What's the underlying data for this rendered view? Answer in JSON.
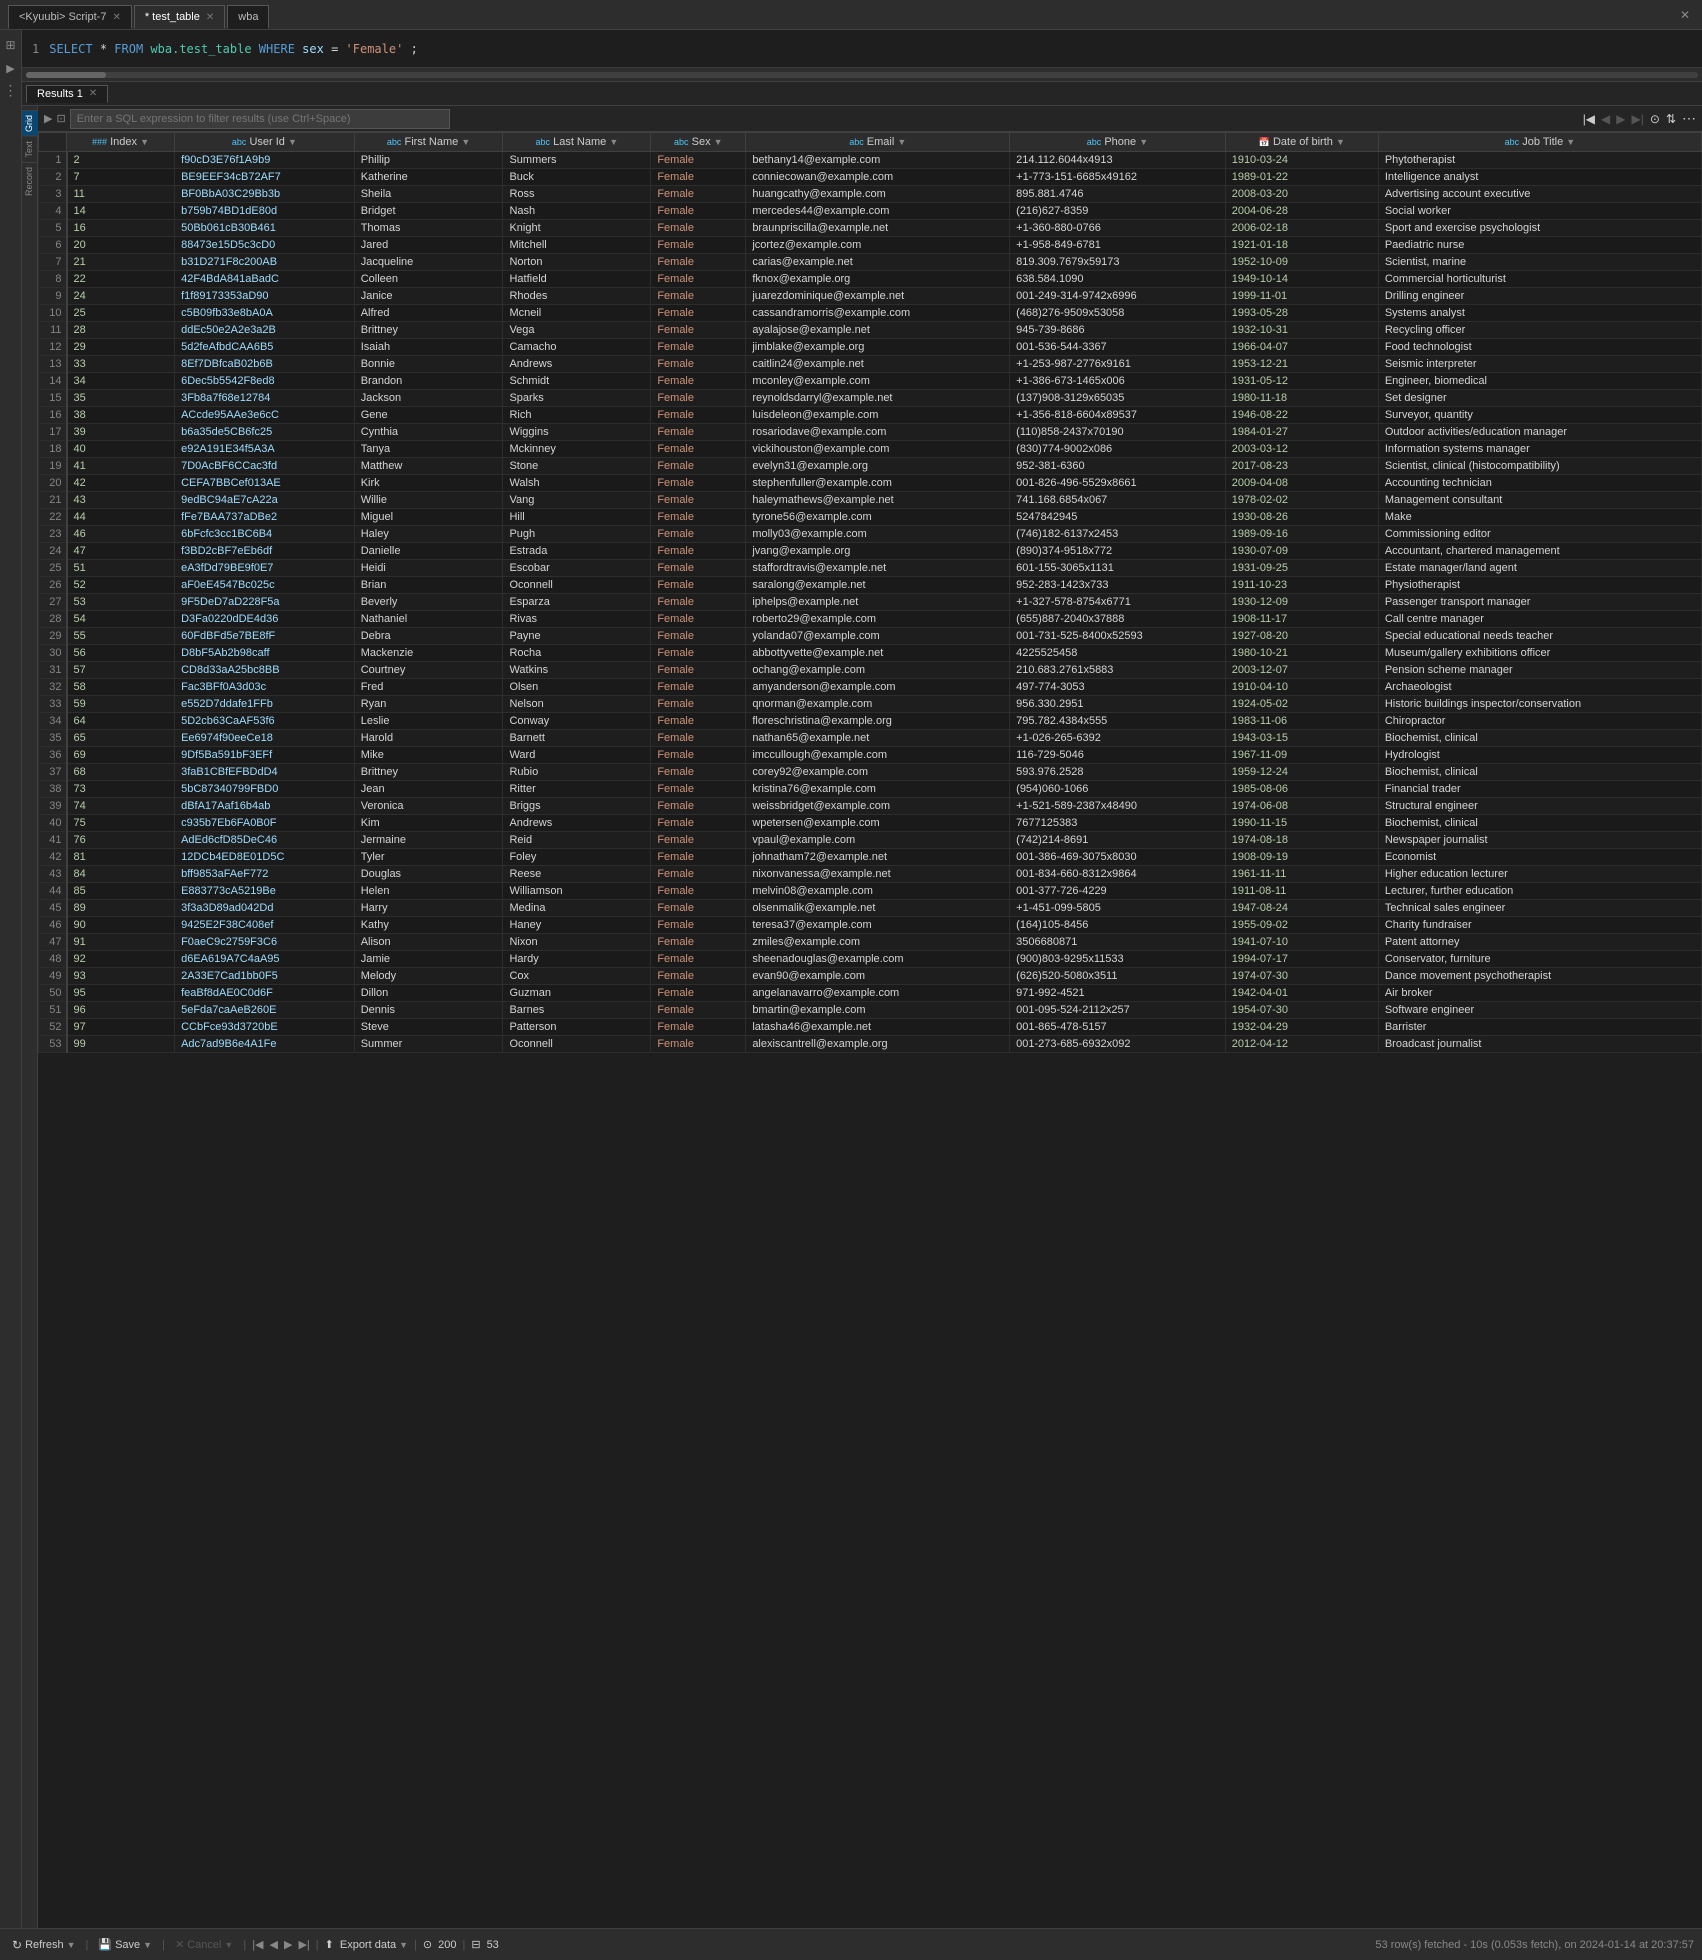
{
  "tabs": [
    {
      "label": "<Kyuubi> Script-7",
      "active": false,
      "closeable": true
    },
    {
      "label": "* test_table",
      "active": true,
      "closeable": true
    },
    {
      "label": "wba",
      "active": false,
      "closeable": false
    }
  ],
  "sql": {
    "line_num": "1",
    "content": "SELECT * FROM wba.test_table WHERE sex = 'Female';"
  },
  "results_tab": "Results 1",
  "filter_placeholder": "Enter a SQL expression to filter results (use Ctrl+Space)",
  "columns": [
    {
      "label": "Index",
      "type": "###"
    },
    {
      "label": "User Id",
      "type": "abc"
    },
    {
      "label": "First Name",
      "type": "abc"
    },
    {
      "label": "Last Name",
      "type": "abc"
    },
    {
      "label": "Sex",
      "type": "abc"
    },
    {
      "label": "Email",
      "type": "abc"
    },
    {
      "label": "Phone",
      "type": "abc"
    },
    {
      "label": "Date of birth",
      "type": "date"
    },
    {
      "label": "Job Title",
      "type": "abc"
    }
  ],
  "rows": [
    [
      1,
      2,
      "f90cD3E76f1A9b9",
      "Phillip",
      "Summers",
      "Female",
      "bethany14@example.com",
      "214.112.6044x4913",
      "1910-03-24",
      "Phytotherapist"
    ],
    [
      2,
      7,
      "BE9EEF34cB72AF7",
      "Katherine",
      "Buck",
      "Female",
      "conniecowan@example.com",
      "+1-773-151-6685x49162",
      "1989-01-22",
      "Intelligence analyst"
    ],
    [
      3,
      11,
      "BF0BbA03C29Bb3b",
      "Sheila",
      "Ross",
      "Female",
      "huangcathy@example.com",
      "895.881.4746",
      "2008-03-20",
      "Advertising account executive"
    ],
    [
      4,
      14,
      "b759b74BD1dE80d",
      "Bridget",
      "Nash",
      "Female",
      "mercedes44@example.com",
      "(216)627-8359",
      "2004-06-28",
      "Social worker"
    ],
    [
      5,
      16,
      "50Bb061cB30B461",
      "Thomas",
      "Knight",
      "Female",
      "braunpriscilla@example.net",
      "+1-360-880-0766",
      "2006-02-18",
      "Sport and exercise psychologist"
    ],
    [
      6,
      20,
      "88473e15D5c3cD0",
      "Jared",
      "Mitchell",
      "Female",
      "jcortez@example.com",
      "+1-958-849-6781",
      "1921-01-18",
      "Paediatric nurse"
    ],
    [
      7,
      21,
      "b31D271F8c200AB",
      "Jacqueline",
      "Norton",
      "Female",
      "carias@example.net",
      "819.309.7679x59173",
      "1952-10-09",
      "Scientist, marine"
    ],
    [
      8,
      22,
      "42F4BdA841aBadC",
      "Colleen",
      "Hatfield",
      "Female",
      "fknox@example.org",
      "638.584.1090",
      "1949-10-14",
      "Commercial horticulturist"
    ],
    [
      9,
      24,
      "f1f89173353aD90",
      "Janice",
      "Rhodes",
      "Female",
      "juarezdominique@example.net",
      "001-249-314-9742x6996",
      "1999-11-01",
      "Drilling engineer"
    ],
    [
      10,
      25,
      "c5B09fb33e8bA0A",
      "Alfred",
      "Mcneil",
      "Female",
      "cassandramorris@example.com",
      "(468)276-9509x53058",
      "1993-05-28",
      "Systems analyst"
    ],
    [
      11,
      28,
      "ddEc50e2A2e3a2B",
      "Brittney",
      "Vega",
      "Female",
      "ayalajose@example.net",
      "945-739-8686",
      "1932-10-31",
      "Recycling officer"
    ],
    [
      12,
      29,
      "5d2feAfbdCAA6B5",
      "Isaiah",
      "Camacho",
      "Female",
      "jimblake@example.org",
      "001-536-544-3367",
      "1966-04-07",
      "Food technologist"
    ],
    [
      13,
      33,
      "8Ef7DBfcaB02b6B",
      "Bonnie",
      "Andrews",
      "Female",
      "caitlin24@example.net",
      "+1-253-987-2776x9161",
      "1953-12-21",
      "Seismic interpreter"
    ],
    [
      14,
      34,
      "6Dec5b5542F8ed8",
      "Brandon",
      "Schmidt",
      "Female",
      "mconley@example.com",
      "+1-386-673-1465x006",
      "1931-05-12",
      "Engineer, biomedical"
    ],
    [
      15,
      35,
      "3Fb8a7f68e12784",
      "Jackson",
      "Sparks",
      "Female",
      "reynoldsdarryl@example.net",
      "(137)908-3129x65035",
      "1980-11-18",
      "Set designer"
    ],
    [
      16,
      38,
      "ACcde95AAe3e6cC",
      "Gene",
      "Rich",
      "Female",
      "luisdeleon@example.com",
      "+1-356-818-6604x89537",
      "1946-08-22",
      "Surveyor, quantity"
    ],
    [
      17,
      39,
      "b6a35de5CB6fc25",
      "Cynthia",
      "Wiggins",
      "Female",
      "rosariodave@example.com",
      "(110)858-2437x70190",
      "1984-01-27",
      "Outdoor activities/education manager"
    ],
    [
      18,
      40,
      "e92A191E34f5A3A",
      "Tanya",
      "Mckinney",
      "Female",
      "vickihouston@example.com",
      "(830)774-9002x086",
      "2003-03-12",
      "Information systems manager"
    ],
    [
      19,
      41,
      "7D0AcBF6CCac3fd",
      "Matthew",
      "Stone",
      "Female",
      "evelyn31@example.org",
      "952-381-6360",
      "2017-08-23",
      "Scientist, clinical (histocompatibility)"
    ],
    [
      20,
      42,
      "CEFA7BBCef013AE",
      "Kirk",
      "Walsh",
      "Female",
      "stephenfuller@example.com",
      "001-826-496-5529x8661",
      "2009-04-08",
      "Accounting technician"
    ],
    [
      21,
      43,
      "9edBC94aE7cA22a",
      "Willie",
      "Vang",
      "Female",
      "haleymathews@example.net",
      "741.168.6854x067",
      "1978-02-02",
      "Management consultant"
    ],
    [
      22,
      44,
      "fFe7BAA737aDBe2",
      "Miguel",
      "Hill",
      "Female",
      "tyrone56@example.com",
      "5247842945",
      "1930-08-26",
      "Make"
    ],
    [
      23,
      46,
      "6bFcfc3cc1BC6B4",
      "Haley",
      "Pugh",
      "Female",
      "molly03@example.com",
      "(746)182-6137x2453",
      "1989-09-16",
      "Commissioning editor"
    ],
    [
      24,
      47,
      "f3BD2cBF7eEb6df",
      "Danielle",
      "Estrada",
      "Female",
      "jvang@example.org",
      "(890)374-9518x772",
      "1930-07-09",
      "Accountant, chartered management"
    ],
    [
      25,
      51,
      "eA3fDd79BE9f0E7",
      "Heidi",
      "Escobar",
      "Female",
      "staffordtravis@example.net",
      "601-155-3065x1131",
      "1931-09-25",
      "Estate manager/land agent"
    ],
    [
      26,
      52,
      "aF0eE4547Bc025c",
      "Brian",
      "Oconnell",
      "Female",
      "saralong@example.net",
      "952-283-1423x733",
      "1911-10-23",
      "Physiotherapist"
    ],
    [
      27,
      53,
      "9F5DeD7aD228F5a",
      "Beverly",
      "Esparza",
      "Female",
      "iphelps@example.net",
      "+1-327-578-8754x6771",
      "1930-12-09",
      "Passenger transport manager"
    ],
    [
      28,
      54,
      "D3Fa0220dDE4d36",
      "Nathaniel",
      "Rivas",
      "Female",
      "roberto29@example.com",
      "(655)887-2040x37888",
      "1908-11-17",
      "Call centre manager"
    ],
    [
      29,
      55,
      "60FdBFd5e7BE8fF",
      "Debra",
      "Payne",
      "Female",
      "yolanda07@example.com",
      "001-731-525-8400x52593",
      "1927-08-20",
      "Special educational needs teacher"
    ],
    [
      30,
      56,
      "D8bF5Ab2b98caff",
      "Mackenzie",
      "Rocha",
      "Female",
      "abbottyvette@example.net",
      "4225525458",
      "1980-10-21",
      "Museum/gallery exhibitions officer"
    ],
    [
      31,
      57,
      "CD8d33aA25bc8BB",
      "Courtney",
      "Watkins",
      "Female",
      "ochang@example.com",
      "210.683.2761x5883",
      "2003-12-07",
      "Pension scheme manager"
    ],
    [
      32,
      58,
      "Fac3BFf0A3d03c",
      "Fred",
      "Olsen",
      "Female",
      "amyanderson@example.com",
      "497-774-3053",
      "1910-04-10",
      "Archaeologist"
    ],
    [
      33,
      59,
      "e552D7ddafe1FFb",
      "Ryan",
      "Nelson",
      "Female",
      "qnorman@example.com",
      "956.330.2951",
      "1924-05-02",
      "Historic buildings inspector/conservation"
    ],
    [
      34,
      64,
      "5D2cb63CaAF53f6",
      "Leslie",
      "Conway",
      "Female",
      "floreschristina@example.org",
      "795.782.4384x555",
      "1983-11-06",
      "Chiropractor"
    ],
    [
      35,
      65,
      "Ee6974f90eeCe18",
      "Harold",
      "Barnett",
      "Female",
      "nathan65@example.net",
      "+1-026-265-6392",
      "1943-03-15",
      "Biochemist, clinical"
    ],
    [
      36,
      69,
      "9Df5Ba591bF3EFf",
      "Mike",
      "Ward",
      "Female",
      "imccullough@example.com",
      "116-729-5046",
      "1967-11-09",
      "Hydrologist"
    ],
    [
      37,
      68,
      "3faB1CBfEFBDdD4",
      "Brittney",
      "Rubio",
      "Female",
      "corey92@example.com",
      "593.976.2528",
      "1959-12-24",
      "Biochemist, clinical"
    ],
    [
      38,
      73,
      "5bC87340799FBD0",
      "Jean",
      "Ritter",
      "Female",
      "kristina76@example.com",
      "(954)060-1066",
      "1985-08-06",
      "Financial trader"
    ],
    [
      39,
      74,
      "dBfA17Aaf16b4ab",
      "Veronica",
      "Briggs",
      "Female",
      "weissbridget@example.com",
      "+1-521-589-2387x48490",
      "1974-06-08",
      "Structural engineer"
    ],
    [
      40,
      75,
      "c935b7Eb6FA0B0F",
      "Kim",
      "Andrews",
      "Female",
      "wpetersen@example.com",
      "7677125383",
      "1990-11-15",
      "Biochemist, clinical"
    ],
    [
      41,
      76,
      "AdEd6cfD85DeC46",
      "Jermaine",
      "Reid",
      "Female",
      "vpaul@example.com",
      "(742)214-8691",
      "1974-08-18",
      "Newspaper journalist"
    ],
    [
      42,
      81,
      "12DCb4ED8E01D5C",
      "Tyler",
      "Foley",
      "Female",
      "johnatham72@example.net",
      "001-386-469-3075x8030",
      "1908-09-19",
      "Economist"
    ],
    [
      43,
      84,
      "bff9853aFAeF772",
      "Douglas",
      "Reese",
      "Female",
      "nixonvanessa@example.net",
      "001-834-660-8312x9864",
      "1961-11-11",
      "Higher education lecturer"
    ],
    [
      44,
      85,
      "E883773cA5219Be",
      "Helen",
      "Williamson",
      "Female",
      "melvin08@example.com",
      "001-377-726-4229",
      "1911-08-11",
      "Lecturer, further education"
    ],
    [
      45,
      89,
      "3f3a3D89ad042Dd",
      "Harry",
      "Medina",
      "Female",
      "olsenmalik@example.net",
      "+1-451-099-5805",
      "1947-08-24",
      "Technical sales engineer"
    ],
    [
      46,
      90,
      "9425E2F38C408ef",
      "Kathy",
      "Haney",
      "Female",
      "teresa37@example.com",
      "(164)105-8456",
      "1955-09-02",
      "Charity fundraiser"
    ],
    [
      47,
      91,
      "F0aeC9c2759F3C6",
      "Alison",
      "Nixon",
      "Female",
      "zmiles@example.com",
      "3506680871",
      "1941-07-10",
      "Patent attorney"
    ],
    [
      48,
      92,
      "d6EA619A7C4aA95",
      "Jamie",
      "Hardy",
      "Female",
      "sheenadouglas@example.com",
      "(900)803-9295x11533",
      "1994-07-17",
      "Conservator, furniture"
    ],
    [
      49,
      93,
      "2A33E7Cad1bb0F5",
      "Melody",
      "Cox",
      "Female",
      "evan90@example.com",
      "(626)520-5080x3511",
      "1974-07-30",
      "Dance movement psychotherapist"
    ],
    [
      50,
      95,
      "feaBf8dAE0C0d6F",
      "Dillon",
      "Guzman",
      "Female",
      "angelanavarro@example.com",
      "971-992-4521",
      "1942-04-01",
      "Air broker"
    ],
    [
      51,
      96,
      "5eFda7caAeB260E",
      "Dennis",
      "Barnes",
      "Female",
      "bmartin@example.com",
      "001-095-524-2112x257",
      "1954-07-30",
      "Software engineer"
    ],
    [
      52,
      97,
      "CCbFce93d3720bE",
      "Steve",
      "Patterson",
      "Female",
      "latasha46@example.net",
      "001-865-478-5157",
      "1932-04-29",
      "Barrister"
    ],
    [
      53,
      99,
      "Adc7ad9B6e4A1Fe",
      "Summer",
      "Oconnell",
      "Female",
      "alexiscantrell@example.org",
      "001-273-685-6932x092",
      "2012-04-12",
      "Broadcast journalist"
    ]
  ],
  "bottom": {
    "refresh_label": "Refresh",
    "save_label": "Save",
    "cancel_label": "Cancel",
    "export_label": "Export data",
    "row_count": "200",
    "page_size": "53",
    "status_text": "53 row(s) fetched - 10s (0.053s fetch), on 2024-01-14 at 20:37:57"
  },
  "sidebar_icons": [
    "grid",
    "text",
    "record"
  ],
  "mode_buttons": [
    "Grid",
    "Text",
    "Record"
  ]
}
